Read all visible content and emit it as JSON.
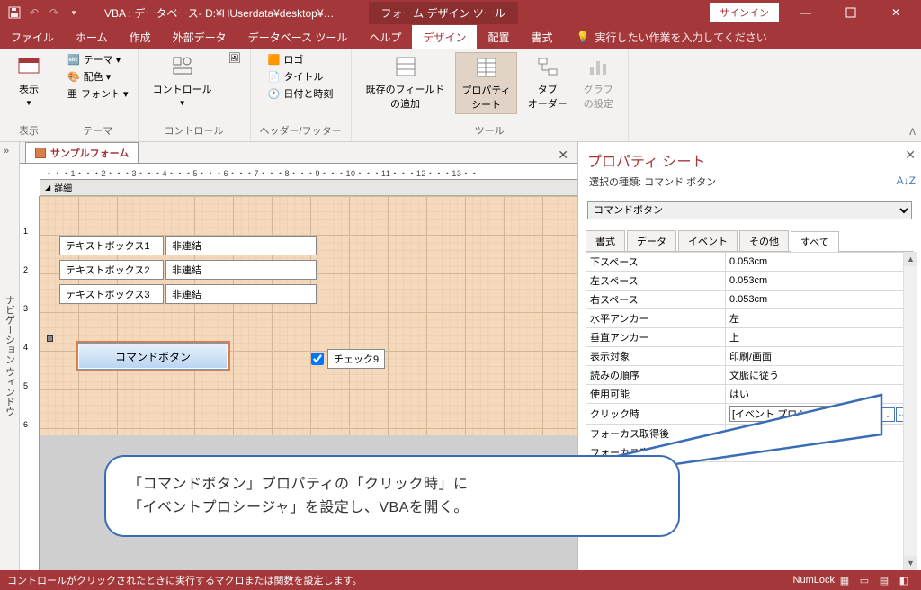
{
  "titlebar": {
    "title": "VBA : データベース- D:¥HUserdata¥desktop¥…",
    "context": "フォーム デザイン ツール",
    "signin": "サインイン"
  },
  "tabs": {
    "file": "ファイル",
    "home": "ホーム",
    "create": "作成",
    "external": "外部データ",
    "dbtools": "データベース ツール",
    "help": "ヘルプ",
    "design": "デザイン",
    "arrange": "配置",
    "format": "書式",
    "tell": "実行したい作業を入力してください"
  },
  "ribbon": {
    "view_btn": "表示",
    "view_grp": "表示",
    "theme": "テーマ ▾",
    "colors": "配色 ▾",
    "fonts": "フォント ▾",
    "theme_grp": "テーマ",
    "controls_btn": "コントロール",
    "controls_grp": "コントロール",
    "logo": "ロゴ",
    "title": "タイトル",
    "datetime": "日付と時刻",
    "hdrftr_grp": "ヘッダー/フッター",
    "addfield": "既存のフィールド\nの追加",
    "propsheet": "プロパティ\nシート",
    "taborder": "タブ\nオーダー",
    "chart": "グラフ\nの設定",
    "tools_grp": "ツール"
  },
  "nav": {
    "label": "ナビゲーション ウィンドウ"
  },
  "doc": {
    "tab": "サンプルフォーム",
    "section": "詳細",
    "ruler_h": "・・・1・・・2・・・3・・・4・・・5・・・6・・・7・・・8・・・9・・・10・・・11・・・12・・・13・・",
    "lbl1": "テキストボックス1",
    "lbl2": "テキストボックス2",
    "lbl3": "テキストボックス3",
    "unbound": "非連結",
    "button": "コマンドボタン",
    "checkbox": "チェック9"
  },
  "propsheet": {
    "title": "プロパティ シート",
    "subtype_lbl": "選択の種類:",
    "subtype_val": "コマンド ボタン",
    "sort": "A↓Z",
    "selector": "コマンドボタン",
    "tabs": {
      "format": "書式",
      "data": "データ",
      "event": "イベント",
      "other": "その他",
      "all": "すべて"
    },
    "rows": [
      {
        "k": "下スペース",
        "v": "0.053cm"
      },
      {
        "k": "左スペース",
        "v": "0.053cm"
      },
      {
        "k": "右スペース",
        "v": "0.053cm"
      },
      {
        "k": "水平アンカー",
        "v": "左"
      },
      {
        "k": "垂直アンカー",
        "v": "上"
      },
      {
        "k": "表示対象",
        "v": "印刷/画面"
      },
      {
        "k": "読みの順序",
        "v": "文脈に従う"
      },
      {
        "k": "使用可能",
        "v": "はい"
      },
      {
        "k": "クリック時",
        "v": "[イベント プロシージャ]",
        "sel": true
      },
      {
        "k": "フォーカス取得後",
        "v": ""
      },
      {
        "k": "フォーカス喪失後",
        "v": ""
      }
    ]
  },
  "callout": {
    "l1": "「コマンドボタン」プロパティの「クリック時」に",
    "l2": "「イベントプロシージャ」を設定し、VBAを開く。"
  },
  "status": {
    "msg": "コントロールがクリックされたときに実行するマクロまたは関数を設定します。",
    "numlock": "NumLock"
  }
}
